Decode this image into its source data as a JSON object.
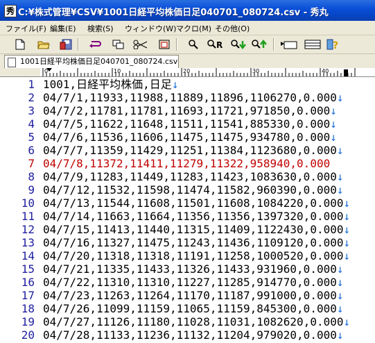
{
  "window": {
    "title": "C:¥株式管理¥CSV¥1001日経平均株価日足040701_080724.csv - 秀丸",
    "icon_name": "hidemaru-app-icon"
  },
  "menu": [
    "ファイル(F)",
    "編集(E)",
    "検索(S)",
    "ウィンドウ(W)",
    "マクロ(M)",
    "その他(O)"
  ],
  "toolbar": {
    "icons": [
      "new-file-icon",
      "open-folder-icon",
      "save-icon",
      "undo-icon",
      "copy-icon",
      "cut-icon",
      "paste-icon",
      "find-icon",
      "replace-icon",
      "find-next-down-icon",
      "find-next-up-icon",
      "tag-jump-icon",
      "split-window-icon",
      "help-icon"
    ]
  },
  "tab": {
    "label": "1001日経平均株価日足040701_080724.csv"
  },
  "ruler": {
    "marks": [
      "0",
      "10",
      "20",
      "30",
      "40"
    ]
  },
  "editor": {
    "current_line": 7,
    "lines": [
      {
        "n": "1",
        "text": "1001,日経平均株価,日足"
      },
      {
        "n": "2",
        "text": "04/7/1,11933,11988,11889,11896,1106270,0.000"
      },
      {
        "n": "3",
        "text": "04/7/2,11781,11781,11693,11721,971850,0.000"
      },
      {
        "n": "4",
        "text": "04/7/5,11622,11648,11511,11541,885330,0.000"
      },
      {
        "n": "5",
        "text": "04/7/6,11536,11606,11475,11475,934780,0.000"
      },
      {
        "n": "6",
        "text": "04/7/7,11359,11429,11251,11384,1123680,0.000"
      },
      {
        "n": "7",
        "text": "04/7/8,11372,11411,11279,11322,958940,0.000"
      },
      {
        "n": "8",
        "text": "04/7/9,11283,11449,11283,11423,1083630,0.000"
      },
      {
        "n": "9",
        "text": "04/7/12,11532,11598,11474,11582,960390,0.000"
      },
      {
        "n": "10",
        "text": "04/7/13,11544,11608,11501,11608,1084220,0.000"
      },
      {
        "n": "11",
        "text": "04/7/14,11663,11664,11356,11356,1397320,0.000"
      },
      {
        "n": "12",
        "text": "04/7/15,11413,11440,11315,11409,1122430,0.000"
      },
      {
        "n": "13",
        "text": "04/7/16,11327,11475,11243,11436,1109120,0.000"
      },
      {
        "n": "14",
        "text": "04/7/20,11318,11318,11191,11258,1000520,0.000"
      },
      {
        "n": "15",
        "text": "04/7/21,11335,11433,11326,11433,931960,0.000"
      },
      {
        "n": "16",
        "text": "04/7/22,11310,11310,11227,11285,914770,0.000"
      },
      {
        "n": "17",
        "text": "04/7/23,11263,11264,11170,11187,991000,0.000"
      },
      {
        "n": "18",
        "text": "04/7/26,11099,11159,11065,11159,845300,0.000"
      },
      {
        "n": "19",
        "text": "04/7/27,11126,11180,11028,11031,1082620,0.000"
      },
      {
        "n": "20",
        "text": "04/7/28,11133,11236,11132,11204,979020,0.000"
      }
    ],
    "eol_glyph": "↓"
  }
}
